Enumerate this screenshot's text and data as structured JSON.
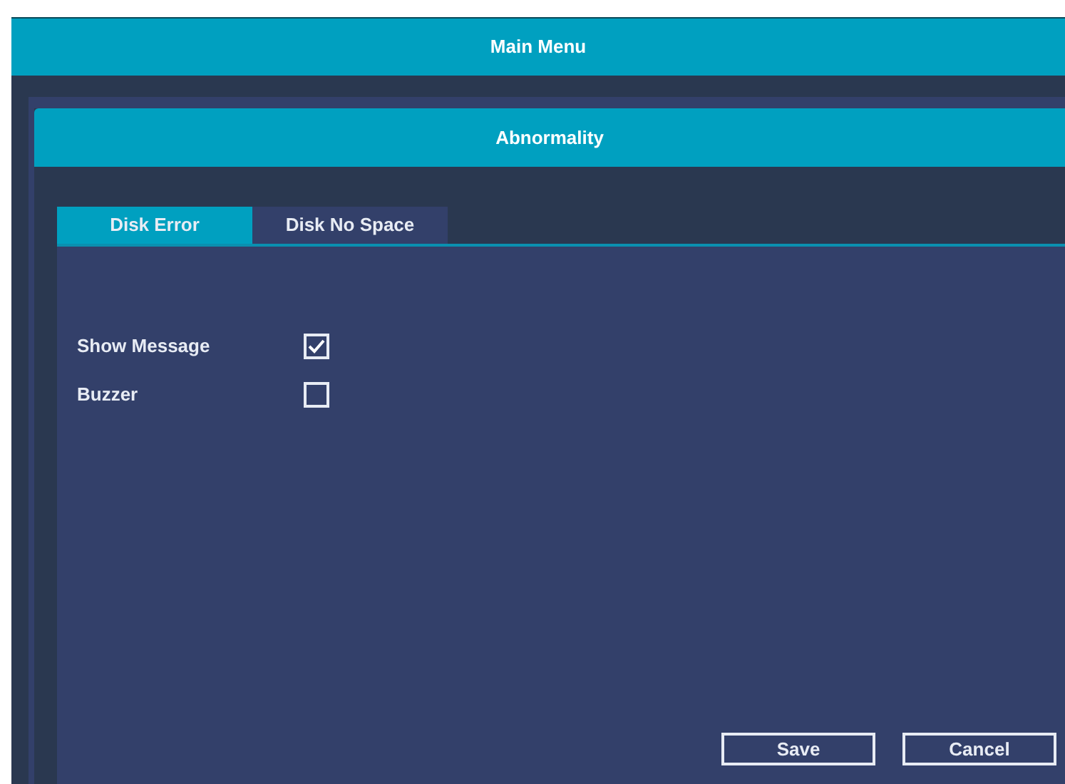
{
  "window": {
    "title": "Main Menu"
  },
  "dialog": {
    "title": "Abnormality"
  },
  "tabs": [
    {
      "label": "Disk Error",
      "selected": true
    },
    {
      "label": "Disk No Space",
      "selected": false
    }
  ],
  "options": [
    {
      "label": "Show Message",
      "checked": true
    },
    {
      "label": "Buzzer",
      "checked": false
    }
  ],
  "buttons": [
    "Save",
    "Cancel"
  ]
}
